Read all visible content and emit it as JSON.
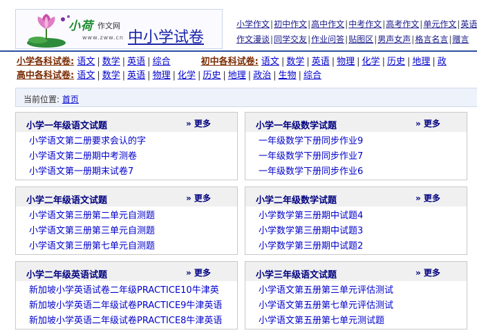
{
  "logo": {
    "script_text": "小荷",
    "small_text": "作文网",
    "url_text": "www.zww.cn",
    "title": "中小学试卷"
  },
  "top_links": {
    "row1": [
      "小学作文",
      "初中作文",
      "高中作文",
      "中考作文",
      "高考作文",
      "单元作文",
      "英语"
    ],
    "row2": [
      "作文漫谈",
      "同学交友",
      "作业问答",
      "贴图区",
      "男声女声",
      "格言名言",
      "赠言"
    ]
  },
  "categories": {
    "primary_label": "小学各科试卷:",
    "primary_items": [
      "语文",
      "数学",
      "英语",
      "综合"
    ],
    "junior_label": "初中各科试卷:",
    "junior_items": [
      "语文",
      "数学",
      "英语",
      "物理",
      "化学",
      "历史",
      "地理",
      "政"
    ],
    "senior_label": "高中各科试卷:",
    "senior_items": [
      "语文",
      "数学",
      "英语",
      "物理",
      "化学",
      "历史",
      "地理",
      "政治",
      "生物",
      "综合"
    ]
  },
  "breadcrumb": {
    "prefix": "当前位置:",
    "home": "首页"
  },
  "more_label": "» 更多",
  "panels": [
    {
      "title": "小学一年级语文试题",
      "items": [
        "小学语文第二册要求会认的字",
        "小学语文第二册期中考测卷",
        "小学语文第一册期末试卷7"
      ]
    },
    {
      "title": "小学一年级数学试题",
      "items": [
        "一年级数学下册同步作业9",
        "一年级数学下册同步作业7",
        "一年级数学下册同步作业6"
      ]
    },
    {
      "title": "小学二年级语文试题",
      "items": [
        "小学语文第三册第二单元自测题",
        "小学语文第三册第三单元自测题",
        "小学语文第三册第七单元自测题"
      ]
    },
    {
      "title": "小学二年级数学试题",
      "items": [
        "小学数学第三册期中试题4",
        "小学数学第三册期中试题3",
        "小学数学第三册期中试题2"
      ]
    },
    {
      "title": "小学二年级英语试题",
      "items": [
        "新加坡小学英语试卷二年级PRACTICE10牛津英",
        "新加坡小学英语二年级试卷PRACTICE9牛津英语",
        "新加坡小学英语二年级试卷PRACTICE8牛津英语"
      ]
    },
    {
      "title": "小学三年级语文试题",
      "items": [
        "小学语文第五册第三单元评估测试",
        "小学语文第五册第七单元评估测试",
        "小学语文第五册第七单元测试题"
      ]
    }
  ]
}
